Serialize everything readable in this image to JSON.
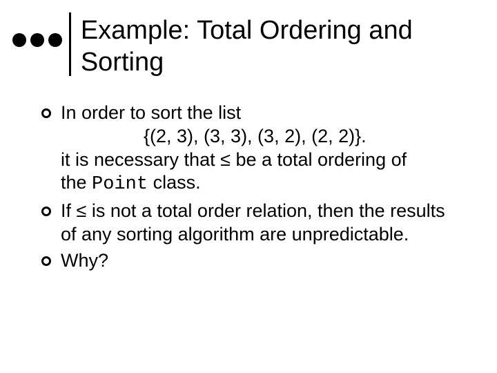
{
  "title": "Example:  Total Ordering and Sorting",
  "items": [
    {
      "line1": "In order to sort the list",
      "set": "{(2, 3), (3, 3), (3, 2), (2, 2)}.",
      "line2a": "it is necessary that ",
      "leq": "≤",
      "line2b": " be a total ordering of",
      "line3a": "the ",
      "code": "Point",
      "line3b": " class."
    },
    {
      "part_a": "If ",
      "leq": "≤",
      "part_b": " is not a total order relation, then the results of any sorting algorithm are unpredictable."
    },
    {
      "text": "Why?"
    }
  ]
}
